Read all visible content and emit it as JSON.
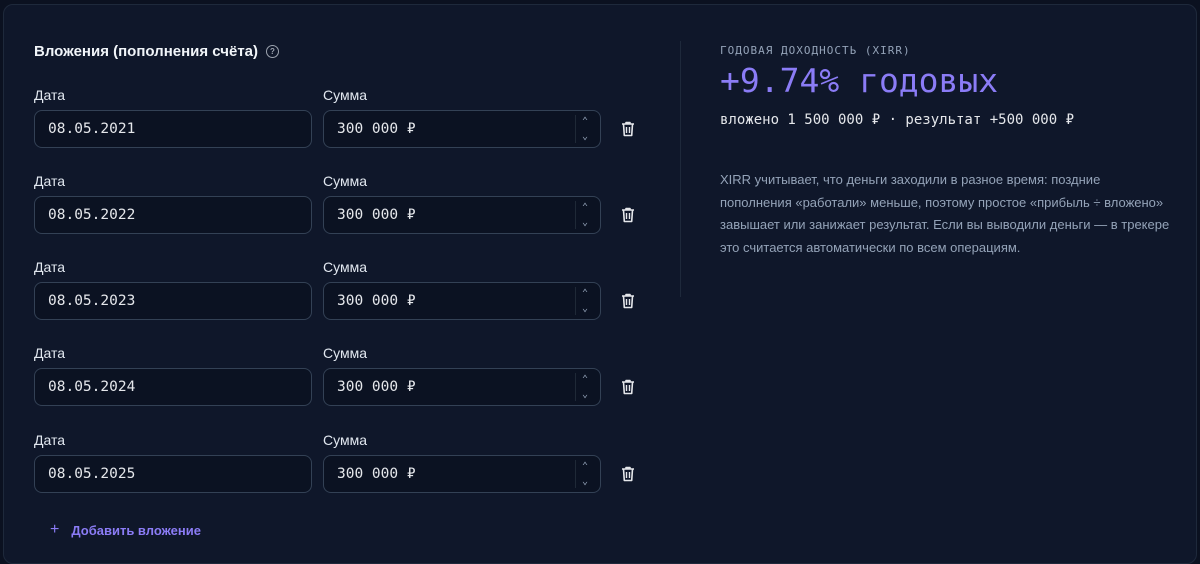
{
  "left": {
    "title": "Вложения (пополнения счёта)",
    "help_icon": "question-circle-icon",
    "date_label": "Дата",
    "amount_label": "Сумма",
    "rows": [
      {
        "date": "08.05.2021",
        "amount": "300 000 ₽"
      },
      {
        "date": "08.05.2022",
        "amount": "300 000 ₽"
      },
      {
        "date": "08.05.2023",
        "amount": "300 000 ₽"
      },
      {
        "date": "08.05.2024",
        "amount": "300 000 ₽"
      },
      {
        "date": "08.05.2025",
        "amount": "300 000 ₽"
      }
    ],
    "add_label": "Добавить вложение",
    "add_icon": "plus-icon",
    "delete_icon": "trash-icon",
    "stepper_up": "^",
    "stepper_down": "v"
  },
  "right": {
    "kicker": "ГОДОВАЯ ДОХОДНОСТЬ (XIRR)",
    "value": "+9.74% годовых",
    "summary": "вложено 1 500 000 ₽ · результат +500 000 ₽",
    "explain": "XIRR учитывает, что деньги заходили в разное время: поздние пополнения «работали» меньше, поэтому простое «прибыль ÷ вложено» завышает или занижает результат. Если вы выводили деньги — в трекере это считается автоматически по всем операциям."
  },
  "colors": {
    "accent": "#8b7cf6",
    "background": "#0f172a",
    "input_border": "#334155"
  }
}
